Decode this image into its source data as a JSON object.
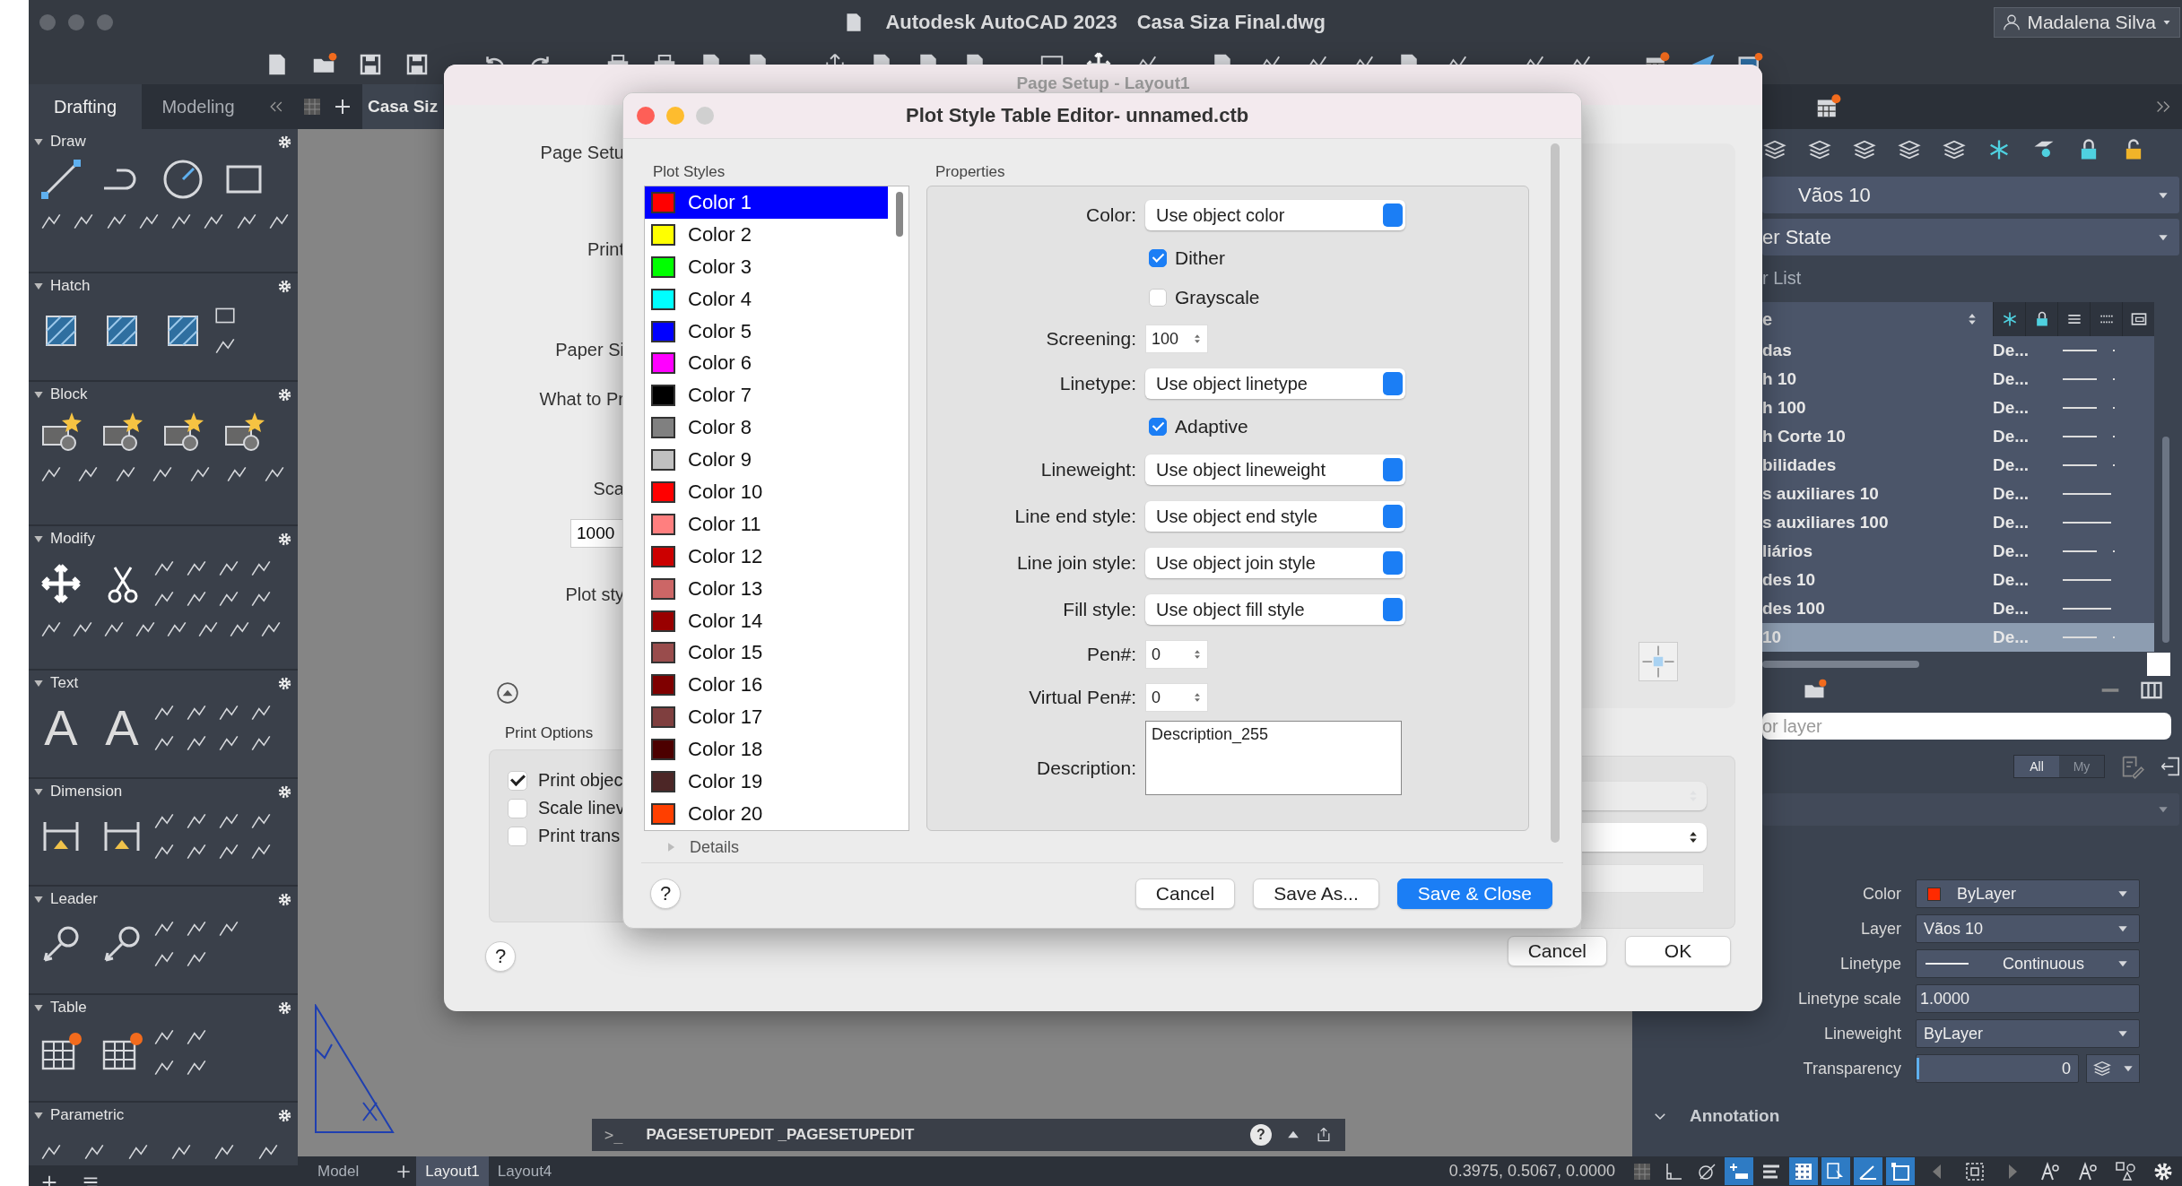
{
  "window": {
    "title": "Autodesk AutoCAD 2023",
    "document": "Casa Siza Final.dwg",
    "user": "Madalena Silva"
  },
  "palette_tabs": [
    {
      "label": "Drafting",
      "selected": true
    },
    {
      "label": "Modeling",
      "selected": false
    }
  ],
  "document_tabs": [
    {
      "label": "Casa Siz",
      "selected": true
    }
  ],
  "palette_sections": [
    {
      "title": "Draw",
      "expanded": true
    },
    {
      "title": "Hatch",
      "expanded": true
    },
    {
      "title": "Block",
      "expanded": true
    },
    {
      "title": "Modify",
      "expanded": true
    },
    {
      "title": "Text",
      "expanded": true,
      "icon_letters": [
        "A",
        "A"
      ]
    },
    {
      "title": "Dimension",
      "expanded": true
    },
    {
      "title": "Leader",
      "expanded": true
    },
    {
      "title": "Table",
      "expanded": true
    },
    {
      "title": "Parametric",
      "expanded": true
    }
  ],
  "page_setup": {
    "title": "Page Setup - Layout1",
    "fields": [
      {
        "kind": "label",
        "text": "Page Setu"
      },
      {
        "kind": "label",
        "text": "Print"
      },
      {
        "kind": "label",
        "text": "Paper Si"
      },
      {
        "kind": "label",
        "text": "What to Pr"
      },
      {
        "kind": "label",
        "text": "Sca"
      },
      {
        "kind": "input",
        "text": "1000"
      },
      {
        "kind": "label",
        "text": "Plot sty"
      }
    ],
    "print_options_title": "Print Options",
    "options": [
      {
        "label": "Print objec",
        "checked": true
      },
      {
        "label": "Scale linev",
        "checked": false
      },
      {
        "label": "Print trans",
        "checked": false
      }
    ],
    "help": "?",
    "buttons": [
      "Cancel",
      "OK"
    ]
  },
  "editor": {
    "title": "Plot Style Table Editor- unnamed.ctb",
    "list_title": "Plot Styles",
    "styles": [
      {
        "name": "Color 1",
        "color": "#ff0000",
        "selected": true
      },
      {
        "name": "Color 2",
        "color": "#ffff00",
        "selected": false
      },
      {
        "name": "Color 3",
        "color": "#00ff00",
        "selected": false
      },
      {
        "name": "Color 4",
        "color": "#00ffff",
        "selected": false
      },
      {
        "name": "Color 5",
        "color": "#0000ff",
        "selected": false
      },
      {
        "name": "Color 6",
        "color": "#ff00ff",
        "selected": false
      },
      {
        "name": "Color 7",
        "color": "#000000",
        "selected": false
      },
      {
        "name": "Color 8",
        "color": "#808080",
        "selected": false
      },
      {
        "name": "Color 9",
        "color": "#c0c0c0",
        "selected": false
      },
      {
        "name": "Color 10",
        "color": "#ff0000",
        "selected": false
      },
      {
        "name": "Color 11",
        "color": "#ff7f7f",
        "selected": false
      },
      {
        "name": "Color 12",
        "color": "#cc0000",
        "selected": false
      },
      {
        "name": "Color 13",
        "color": "#cc6666",
        "selected": false
      },
      {
        "name": "Color 14",
        "color": "#990000",
        "selected": false
      },
      {
        "name": "Color 15",
        "color": "#994c4c",
        "selected": false
      },
      {
        "name": "Color 16",
        "color": "#7f0000",
        "selected": false
      },
      {
        "name": "Color 17",
        "color": "#7f3f3f",
        "selected": false
      },
      {
        "name": "Color 18",
        "color": "#4c0000",
        "selected": false
      },
      {
        "name": "Color 19",
        "color": "#4c2626",
        "selected": false
      },
      {
        "name": "Color 20",
        "color": "#ff3f00",
        "selected": false
      }
    ],
    "properties_title": "Properties",
    "properties": [
      {
        "kind": "select",
        "label": "Color:",
        "value": "Use object color"
      },
      {
        "kind": "check",
        "label": "Dither",
        "checked": true
      },
      {
        "kind": "check",
        "label": "Grayscale",
        "checked": false
      },
      {
        "kind": "spin",
        "label": "Screening:",
        "value": "100"
      },
      {
        "kind": "select",
        "label": "Linetype:",
        "value": "Use object linetype"
      },
      {
        "kind": "check",
        "label": "Adaptive",
        "checked": true
      },
      {
        "kind": "select",
        "label": "Lineweight:",
        "value": "Use object lineweight"
      },
      {
        "kind": "select",
        "label": "Line end style:",
        "value": "Use object end style"
      },
      {
        "kind": "select",
        "label": "Line join style:",
        "value": "Use object join style"
      },
      {
        "kind": "select",
        "label": "Fill style:",
        "value": "Use object fill style"
      },
      {
        "kind": "spin",
        "label": "Pen#:",
        "value": "0"
      },
      {
        "kind": "spin",
        "label": "Virtual Pen#:",
        "value": "0"
      },
      {
        "kind": "textarea",
        "label": "Description:",
        "value": "Description_255"
      }
    ],
    "details": {
      "label": "Details",
      "expanded": false
    },
    "help": "?",
    "buttons": [
      {
        "label": "Cancel",
        "primary": false
      },
      {
        "label": "Save As...",
        "primary": false
      },
      {
        "label": "Save & Close",
        "primary": true
      }
    ]
  },
  "right_panel": {
    "layer_dropdown": "Vãos 10",
    "state_dropdown": "er State",
    "list_label": "r List",
    "name_header": "e",
    "layers": [
      {
        "name": "das",
        "description": "De...",
        "long_line": false,
        "selected": false
      },
      {
        "name": "h 10",
        "description": "De...",
        "long_line": false,
        "selected": false
      },
      {
        "name": "h 100",
        "description": "De...",
        "long_line": false,
        "selected": false
      },
      {
        "name": "h Corte 10",
        "description": "De...",
        "long_line": false,
        "selected": false
      },
      {
        "name": "bilidades",
        "description": "De...",
        "long_line": false,
        "selected": false
      },
      {
        "name": "s auxiliares 10",
        "description": "De...",
        "long_line": true,
        "selected": false
      },
      {
        "name": "s auxiliares 100",
        "description": "De...",
        "long_line": true,
        "selected": false
      },
      {
        "name": "liários",
        "description": "De...",
        "long_line": false,
        "selected": false
      },
      {
        "name": "des 10",
        "description": "De...",
        "long_line": true,
        "selected": false
      },
      {
        "name": "des 100",
        "description": "De...",
        "long_line": true,
        "selected": false
      },
      {
        "name": "10",
        "description": "De...",
        "long_line": false,
        "selected": true
      }
    ],
    "search_placeholder": "or layer",
    "filter_tabs": [
      {
        "label": "All",
        "selected": true
      },
      {
        "label": "My",
        "selected": false
      }
    ],
    "properties": [
      {
        "kind": "color",
        "label": "Color",
        "value": "ByLayer",
        "color": "#ff2a00"
      },
      {
        "kind": "select",
        "label": "Layer",
        "value": "Vãos 10"
      },
      {
        "kind": "linetype",
        "label": "Linetype",
        "value": "Continuous"
      },
      {
        "kind": "text",
        "label": "Linetype scale",
        "value": "1.0000"
      },
      {
        "kind": "select",
        "label": "Lineweight",
        "value": "ByLayer"
      },
      {
        "kind": "slider",
        "label": "Transparency",
        "value": "0",
        "level": 0
      }
    ],
    "section": {
      "title": "Annotation",
      "expanded": true
    }
  },
  "command_line": {
    "prompt": ">_",
    "text": "PAGESETUPEDIT _PAGESETUPEDIT",
    "help": "?"
  },
  "layout_tabs": [
    {
      "label": "Model",
      "selected": false
    },
    {
      "label": "Layout1",
      "selected": true
    },
    {
      "label": "Layout4",
      "selected": false
    }
  ],
  "coordinates": "0.3975, 0.5067, 0.0000",
  "status_toggles": [
    {
      "kind": "grid",
      "on": false
    },
    {
      "kind": "ortho",
      "on": false
    },
    {
      "kind": "polar",
      "on": false
    },
    {
      "kind": "dynamic",
      "on": true
    },
    {
      "kind": "lineweight",
      "on": false
    },
    {
      "kind": "transparency",
      "on": true
    },
    {
      "kind": "selection",
      "on": true
    },
    {
      "kind": "angle",
      "on": true
    },
    {
      "kind": "viewport",
      "on": true
    }
  ]
}
